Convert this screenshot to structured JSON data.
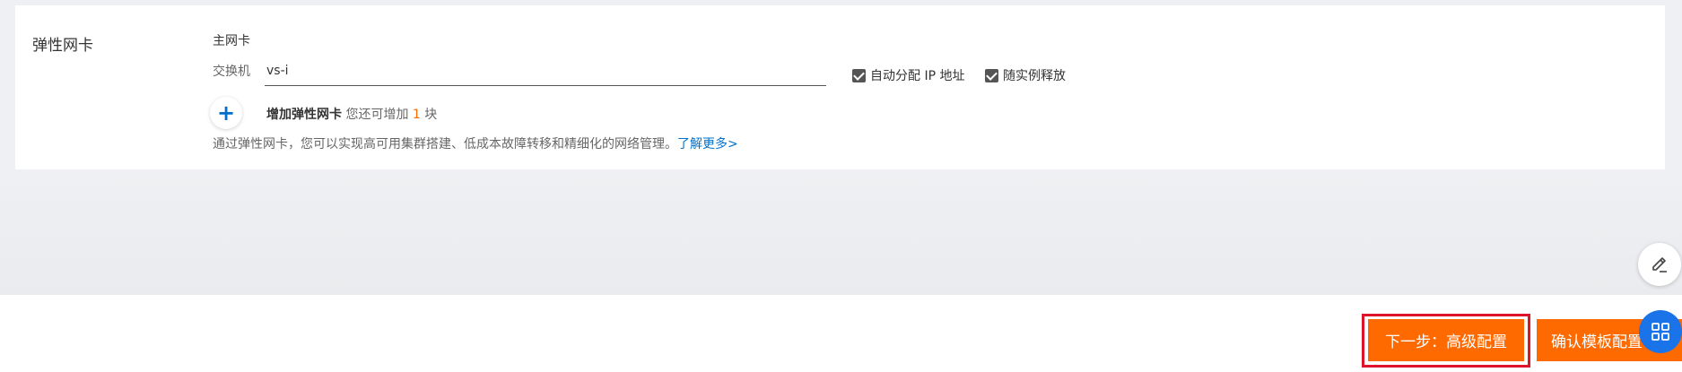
{
  "section": {
    "label": "弹性网卡"
  },
  "primary_nic": {
    "label": "主网卡",
    "switch_label": "交换机",
    "switch_value": "vs-i",
    "auto_ip_label": "自动分配 IP 地址",
    "release_with_instance_label": "随实例释放"
  },
  "add_nic": {
    "icon": "plus-icon",
    "title": "增加弹性网卡",
    "remaining_prefix": "您还可增加",
    "remaining_count": "1",
    "remaining_suffix": "块"
  },
  "description": {
    "text": "通过弹性网卡，您可以实现高可用集群搭建、低成本故障转移和精细化的网络管理。",
    "link": "了解更多>"
  },
  "footer": {
    "next_button": "下一步：高级配置",
    "confirm_button": "确认模板配置"
  },
  "floating": {
    "edit_icon": "edit-icon",
    "apps_icon": "grid-apps-icon"
  },
  "colors": {
    "accent_orange": "#ff6a00",
    "link_blue": "#0070cc",
    "highlight_red": "#e0142a",
    "float_blue": "#1a73e8"
  }
}
